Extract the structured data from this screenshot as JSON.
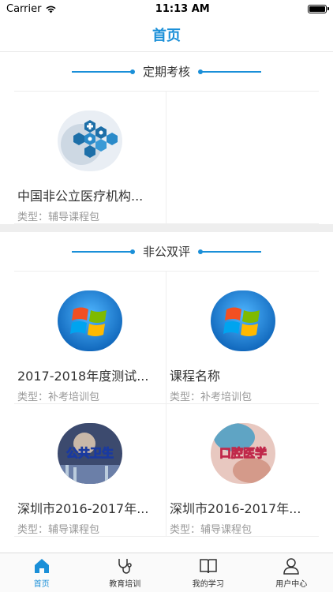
{
  "status": {
    "carrier": "Carrier",
    "time": "11:13 AM"
  },
  "nav": {
    "title": "首页"
  },
  "sections": [
    {
      "title": "定期考核",
      "cards": [
        {
          "title": "中国非公立医疗机构...",
          "type": "类型：辅导课程包",
          "icon": "medical-tech-thumbnail"
        }
      ]
    },
    {
      "title": "非公双评",
      "cards": [
        {
          "title": "2017-2018年度测试...",
          "type": "类型：补考培训包",
          "icon": "windows-logo-thumbnail"
        },
        {
          "title": "课程名称",
          "type": "类型：补考培训包",
          "icon": "windows-logo-thumbnail"
        },
        {
          "title": "深圳市2016-2017年...",
          "type": "类型：辅导课程包",
          "icon": "public-health-thumbnail",
          "badge": "公共卫生"
        },
        {
          "title": "深圳市2016-2017年...",
          "type": "类型：辅导课程包",
          "icon": "oral-medicine-thumbnail",
          "badge": "口腔医学"
        }
      ]
    }
  ],
  "tabs": [
    {
      "label": "首页",
      "icon": "home-icon",
      "active": true
    },
    {
      "label": "教育培训",
      "icon": "stethoscope-icon",
      "active": false
    },
    {
      "label": "我的学习",
      "icon": "book-icon",
      "active": false
    },
    {
      "label": "用户中心",
      "icon": "user-icon",
      "active": false
    }
  ],
  "colors": {
    "accent": "#1a8fd8",
    "divider": "#eeeeee"
  }
}
